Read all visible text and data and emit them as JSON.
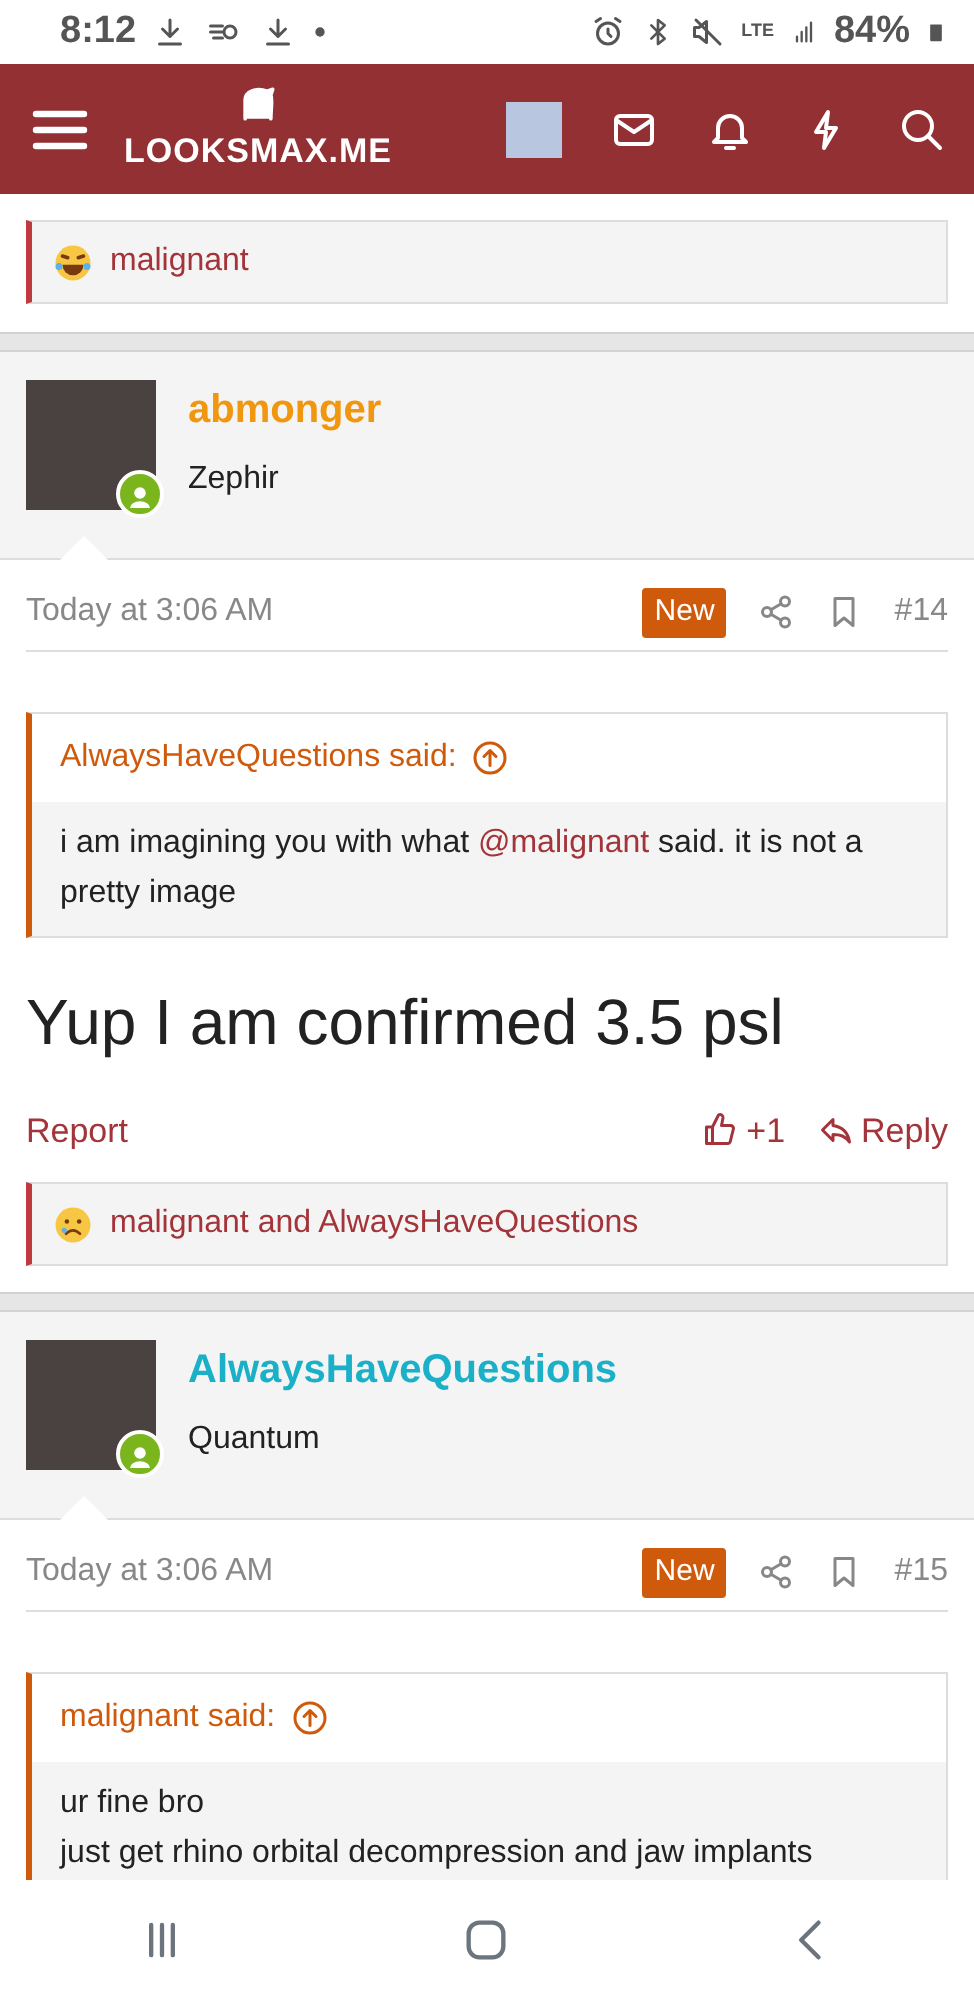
{
  "status_bar": {
    "time": "8:12",
    "battery": "84%",
    "network": "LTE"
  },
  "header": {
    "logo": "LOOKSMAX.ME"
  },
  "top_reaction": {
    "kind": "laugh",
    "text": "malignant"
  },
  "posts": [
    {
      "username": "abmonger",
      "color": "#f0960f",
      "rank": "Zephir",
      "online": true,
      "time": "Today at 3:06 AM",
      "badge": "New",
      "number": "#14",
      "quote": {
        "author": "AlwaysHaveQuestions said:",
        "lines": [
          "i am imagining you with what **@malignant** said. it is not a pretty image"
        ]
      },
      "message": "Yup I am confirmed 3.5 psl",
      "actions": {
        "report": "Report",
        "likes": "+1",
        "reply": "Reply"
      },
      "reaction": {
        "kind": "sad",
        "text": "malignant and AlwaysHaveQuestions"
      }
    },
    {
      "username": "AlwaysHaveQuestions",
      "color": "#1ab0c8",
      "rank": "Quantum",
      "online": true,
      "time": "Today at 3:06 AM",
      "badge": "New",
      "number": "#15",
      "quote": {
        "author": "malignant said:",
        "lines": [
          "ur fine bro",
          "just get rhino orbital decompression and jaw implants"
        ]
      }
    }
  ]
}
